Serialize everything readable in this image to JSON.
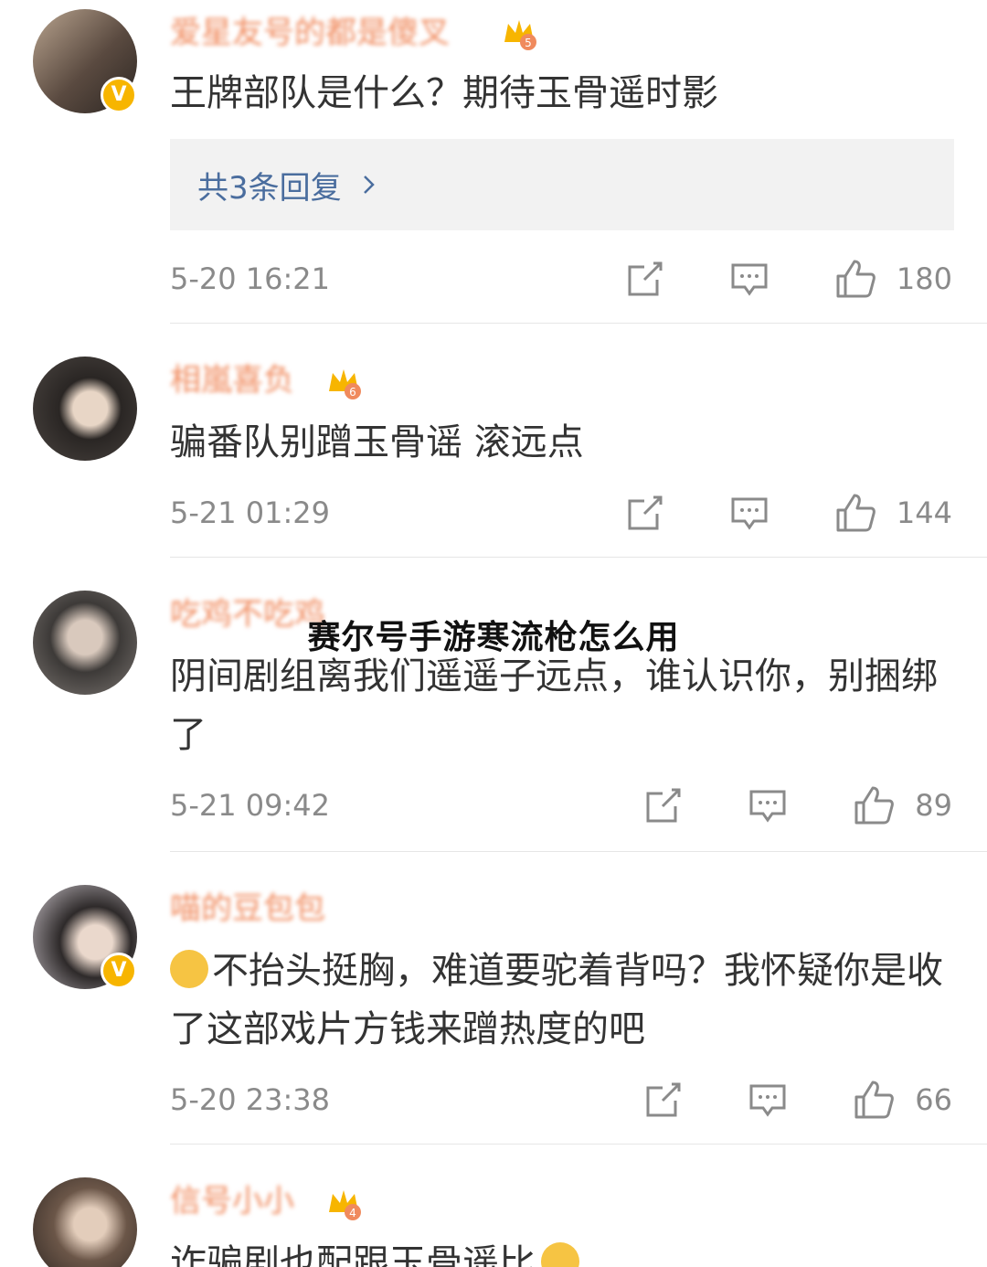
{
  "overlay_title": "赛尔号手游寒流枪怎么用",
  "comments": [
    {
      "username": "爱星友号的都是傻叉",
      "badge_level": "5",
      "text": "王牌部队是什么？期待玉骨遥时影",
      "replies_label": "共3条回复",
      "time": "5-20 16:21",
      "likes": "180",
      "verified": "V"
    },
    {
      "username": "相嵐喜负",
      "badge_level": "6",
      "text": "骗番队别蹭玉骨谣 滚远点",
      "time": "5-21 01:29",
      "likes": "144"
    },
    {
      "username": "吃鸡不吃鸡",
      "text": "阴间剧组离我们遥遥子远点，谁认识你，别捆绑了",
      "time": "5-21 09:42",
      "likes": "89"
    },
    {
      "username": "喵的豆包包",
      "text": "不抬头挺胸，难道要驼着背吗？我怀疑你是收了这部戏片方钱来蹭热度的吧",
      "time": "5-20 23:38",
      "likes": "66",
      "verified": "V"
    },
    {
      "username": "信号小小",
      "badge_level": "4",
      "text": "诈骗剧也配跟玉骨遥比"
    }
  ],
  "colors": {
    "username": "#f08a5d",
    "link": "#4a6d9e",
    "meta": "#8a8a8a",
    "verified": "#f7b500"
  },
  "icons": [
    "share-icon",
    "comment-icon",
    "like-icon",
    "chevron-right-icon",
    "verified-icon",
    "crown-badge-icon"
  ]
}
